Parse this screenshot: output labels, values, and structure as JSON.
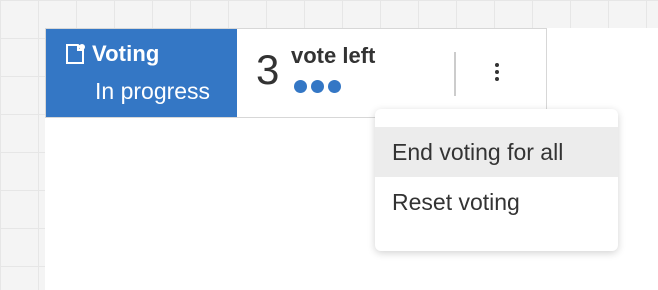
{
  "voting": {
    "status_title": "Voting",
    "status_subtitle": "In progress",
    "votes_left_count": "3",
    "votes_left_label": "vote left",
    "vote_dots": 3
  },
  "menu": {
    "items": [
      {
        "label": "End voting for all"
      },
      {
        "label": "Reset voting"
      }
    ]
  },
  "colors": {
    "accent": "#3477c5",
    "background": "#f4f4f4",
    "surface": "#ffffff",
    "text": "#333333",
    "menu_hover": "#ececec"
  },
  "icons": {
    "status_icon": "note-icon",
    "more_icon": "more-vertical-icon"
  }
}
